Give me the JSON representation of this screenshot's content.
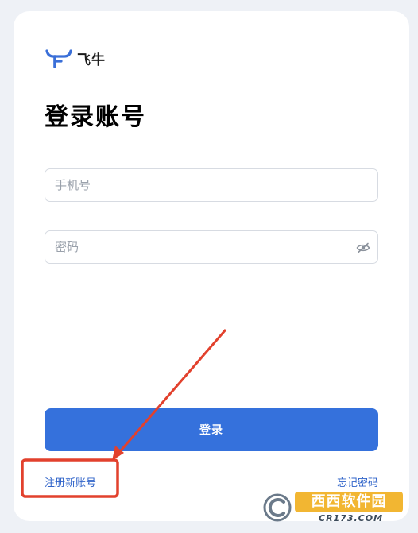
{
  "brand": {
    "name": "飞牛",
    "logo_icon": "bull-horns-icon",
    "logo_color": "#3a6fd8"
  },
  "title": "登录账号",
  "form": {
    "phone": {
      "placeholder": "手机号",
      "value": ""
    },
    "password": {
      "placeholder": "密码",
      "value": "",
      "toggle_icon": "eye-slash-icon"
    },
    "submit_label": "登录"
  },
  "links": {
    "register": "注册新账号",
    "forgot_password": "忘记密码"
  },
  "colors": {
    "primary": "#3571dc",
    "link": "#2f63c9",
    "annotation": "#e2412d",
    "background": "#eef1f6"
  },
  "watermark": {
    "title": "西西软件园",
    "url": "CR173.COM"
  }
}
